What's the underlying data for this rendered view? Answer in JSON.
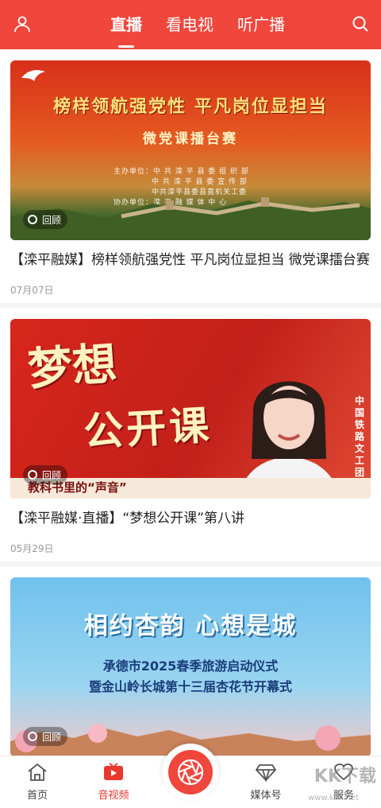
{
  "header": {
    "tabs": [
      {
        "label": "直播",
        "active": true
      },
      {
        "label": "看电视",
        "active": false
      },
      {
        "label": "听广播",
        "active": false
      }
    ],
    "accent": "#f0463c"
  },
  "feed": [
    {
      "art": {
        "headline": "榜样领航强党性  平凡岗位显担当",
        "subline": "微党课播台赛",
        "org_lines": [
          "主办单位：中 共 滦 平 县 委 组 织 部",
          "中 共 滦 平 县 委 宣 传 部",
          "中共滦平县委县直机关工委",
          "协办单位：滦 平 融 媒 体 中 心"
        ]
      },
      "badge": "回顾",
      "title": "【滦平融媒】榜样领航强党性 平凡岗位显担当 微党课擂台赛",
      "date": "07月07日"
    },
    {
      "art": {
        "big1": "梦想",
        "big2": "公开课",
        "strip": "教科书里的“声音”",
        "side": "中国铁路文工团歌唱"
      },
      "badge": "回顾",
      "title": "【滦平融媒·直播】“梦想公开课”第八讲",
      "date": "05月29日"
    },
    {
      "art": {
        "headline": "相约杏韵 心想是城",
        "line1": "承德市2025春季旅游启动仪式",
        "line2": "暨金山岭长城第十三届杏花节开幕式"
      },
      "badge": "回顾"
    }
  ],
  "bottom_nav": [
    {
      "label": "首页",
      "icon": "home-icon"
    },
    {
      "label": "音视频",
      "icon": "play-icon",
      "active": true
    },
    {
      "label": "",
      "icon": "camera-shutter-icon"
    },
    {
      "label": "媒体号",
      "icon": "diamond-icon"
    },
    {
      "label": "服务",
      "icon": "heart-icon"
    }
  ],
  "watermark": {
    "text": "KK下载",
    "url": "www.kkx.net"
  }
}
